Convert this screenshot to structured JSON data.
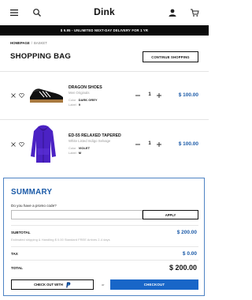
{
  "header": {
    "logo": "Dink",
    "icons": [
      "menu-icon",
      "search-icon",
      "user-icon",
      "cart-icon"
    ]
  },
  "promo_bar": {
    "text": "$ 9.95 - UNLIMITED NEXT-DAY DELIVERY FOR 1 YR"
  },
  "breadcrumb": {
    "home": "HOMEPAGE",
    "separator": "/",
    "current": "BASKET"
  },
  "page": {
    "title": "SHOPPING BAG",
    "continue_label": "CONTINUE SHOPPING"
  },
  "items": [
    {
      "name": "DRAGON SHOES",
      "brand": "Men Originals",
      "attr1_label": "Color",
      "attr1_value": "DARK GREY",
      "attr2_label": "Label",
      "attr2_value": "9",
      "quantity": "1",
      "price": "$ 100.00"
    },
    {
      "name": "ED-55 RELAXED TAPERED",
      "brand": "White Listed Indigo Selvage",
      "attr1_label": "Color",
      "attr1_value": "VIOLET",
      "attr2_label": "Label",
      "attr2_value": "M",
      "quantity": "1",
      "price": "$ 100.00"
    }
  ],
  "summary": {
    "title": "SUMMARY",
    "promo_question": "Do you have a promo code?",
    "promo_value": "",
    "apply_label": "APPLY",
    "subtotal_label": "SUBTOTAL",
    "subtotal_value": "$ 200.00",
    "shipping_note": "Estimated shipping & Handling $ 0.00 Standard  FREE Arrives 2-4 days",
    "tax_label": "TAX",
    "tax_value": "$ 0.00",
    "total_label": "TOTAL",
    "total_value": "$ 200.00",
    "paypal_label": "CHECK OUT WITH",
    "or_text": "or",
    "checkout_label": "CHECKOUT"
  },
  "colors": {
    "accent": "#1c5ba8",
    "checkout_button": "#1866c8",
    "promo_bar": "#0b0b0b"
  }
}
